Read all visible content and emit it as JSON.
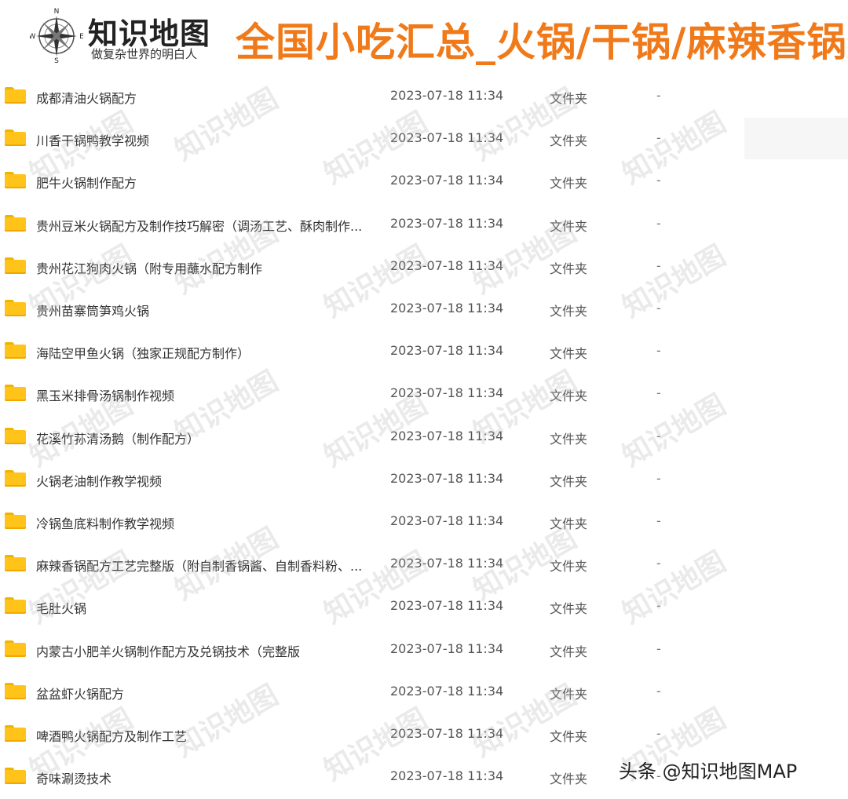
{
  "header": {
    "logo_text": "知识地图",
    "logo_sub": "做复杂世界的明白人",
    "compass_letter_n": "N",
    "compass_letter_s": "S",
    "compass_letter_e": "E",
    "compass_letter_w": "W",
    "banner_title": "全国小吃汇总_火锅/干锅/麻辣香锅"
  },
  "files": [
    {
      "name": "成都清油火锅配方",
      "date": "2023-07-18 11:34",
      "type": "文件夹",
      "size": "-"
    },
    {
      "name": "川香干锅鸭教学视频",
      "date": "2023-07-18 11:34",
      "type": "文件夹",
      "size": "-"
    },
    {
      "name": "肥牛火锅制作配方",
      "date": "2023-07-18 11:34",
      "type": "文件夹",
      "size": "-"
    },
    {
      "name": "贵州豆米火锅配方及制作技巧解密（调汤工艺、酥肉制作...",
      "date": "2023-07-18 11:34",
      "type": "文件夹",
      "size": "-"
    },
    {
      "name": "贵州花江狗肉火锅（附专用蘸水配方制作",
      "date": "2023-07-18 11:34",
      "type": "文件夹",
      "size": "-"
    },
    {
      "name": "贵州苗寨筒笋鸡火锅",
      "date": "2023-07-18 11:34",
      "type": "文件夹",
      "size": "-"
    },
    {
      "name": "海陆空甲鱼火锅（独家正规配方制作）",
      "date": "2023-07-18 11:34",
      "type": "文件夹",
      "size": "-"
    },
    {
      "name": "黑玉米排骨汤锅制作视频",
      "date": "2023-07-18 11:34",
      "type": "文件夹",
      "size": "-"
    },
    {
      "name": "花溪竹荪清汤鹅（制作配方）",
      "date": "2023-07-18 11:34",
      "type": "文件夹",
      "size": "-"
    },
    {
      "name": "火锅老油制作教学视频",
      "date": "2023-07-18 11:34",
      "type": "文件夹",
      "size": "-"
    },
    {
      "name": "冷锅鱼底料制作教学视频",
      "date": "2023-07-18 11:34",
      "type": "文件夹",
      "size": "-"
    },
    {
      "name": "麻辣香锅配方工艺完整版（附自制香锅酱、自制香料粉、...",
      "date": "2023-07-18 11:34",
      "type": "文件夹",
      "size": "-"
    },
    {
      "name": "毛肚火锅",
      "date": "2023-07-18 11:34",
      "type": "文件夹",
      "size": "-"
    },
    {
      "name": "内蒙古小肥羊火锅制作配方及兑锅技术（完整版",
      "date": "2023-07-18 11:34",
      "type": "文件夹",
      "size": "-"
    },
    {
      "name": "盆盆虾火锅配方",
      "date": "2023-07-18 11:34",
      "type": "文件夹",
      "size": "-"
    },
    {
      "name": "啤酒鸭火锅配方及制作工艺",
      "date": "2023-07-18 11:34",
      "type": "文件夹",
      "size": "-"
    },
    {
      "name": "奇味涮烫技术",
      "date": "2023-07-18 11:34",
      "type": "文件夹",
      "size": "-"
    }
  ],
  "watermark_text": "知识地图",
  "footer_mark": "头条 @知识地图MAP",
  "colors": {
    "banner": "#f07a1a",
    "folder": "#ffc31a"
  }
}
